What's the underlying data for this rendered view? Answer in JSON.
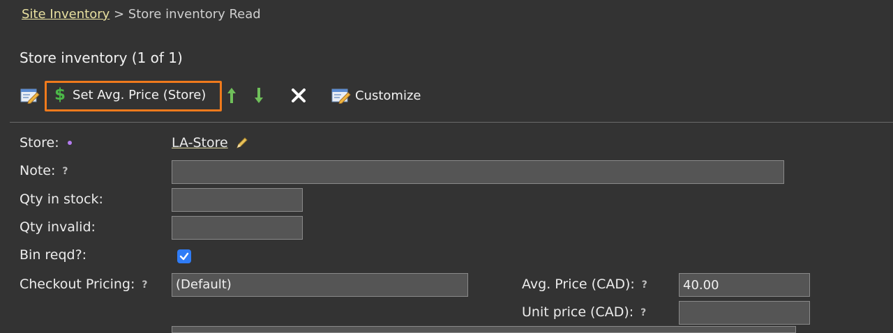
{
  "breadcrumb": {
    "link": "Site Inventory",
    "separator": " > ",
    "current": "Store inventory Read"
  },
  "page_title": "Store inventory (1 of 1)",
  "toolbar": {
    "set_avg_price_label": "Set Avg. Price (Store)",
    "customize_label": "Customize"
  },
  "form": {
    "store_label": "Store:",
    "store_value": "LA-Store",
    "note_label": "Note:",
    "note_value": "",
    "qty_in_stock_label": "Qty in stock:",
    "qty_in_stock_value": "",
    "qty_invalid_label": "Qty invalid:",
    "qty_invalid_value": "",
    "bin_reqd_label": "Bin reqd?:",
    "bin_reqd_checked": true,
    "checkout_pricing_label": "Checkout Pricing:",
    "checkout_pricing_value": "(Default)",
    "avg_price_label": "Avg. Price (CAD):",
    "avg_price_value": "40.00",
    "unit_price_label": "Unit price (CAD):",
    "unit_price_value": ""
  },
  "help_glyph": "?",
  "colors": {
    "background": "#333333",
    "highlight": "#f07a1c",
    "link": "#e8e0a0",
    "checkbox": "#2f7cf6",
    "arrow": "#6fbf5a"
  }
}
